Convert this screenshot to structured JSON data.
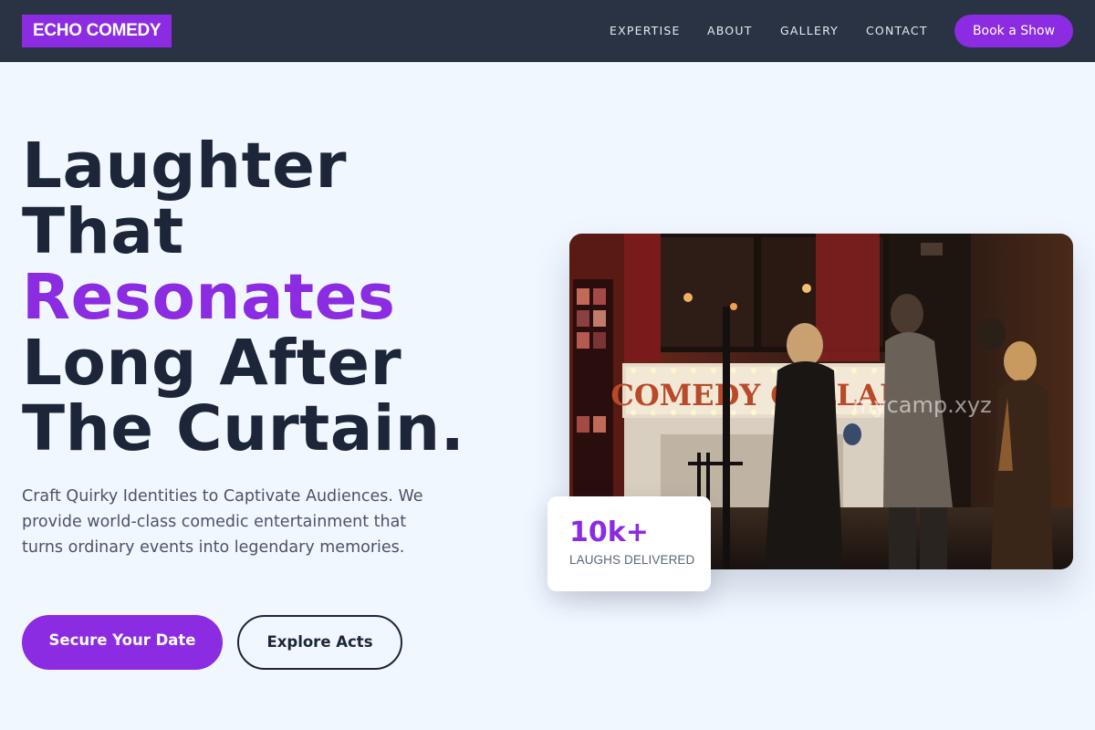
{
  "header": {
    "logo": "ECHO COMEDY",
    "nav": [
      "EXPERTISE",
      "ABOUT",
      "GALLERY",
      "CONTACT"
    ],
    "book_button": "Book a Show"
  },
  "hero": {
    "headline_lines": [
      "Laughter",
      "That",
      "Resonates",
      "Long After",
      "The Curtain."
    ],
    "subtext": "Craft Quirky Identities to Captivate Audiences. We provide world-class comedic entertainment that turns ordinary events into legendary memories.",
    "primary_cta": "Secure Your Date",
    "secondary_cta": "Explore Acts"
  },
  "image": {
    "sign_text": "COMEDY CELLAR",
    "watermark": "mycamp.xyz"
  },
  "stat": {
    "value": "10k+",
    "label": "LAUGHS DELIVERED"
  },
  "colors": {
    "accent": "#8b2be2",
    "header_bg": "#2a3343",
    "page_bg": "#f0f7ff",
    "heading": "#1c2638"
  }
}
